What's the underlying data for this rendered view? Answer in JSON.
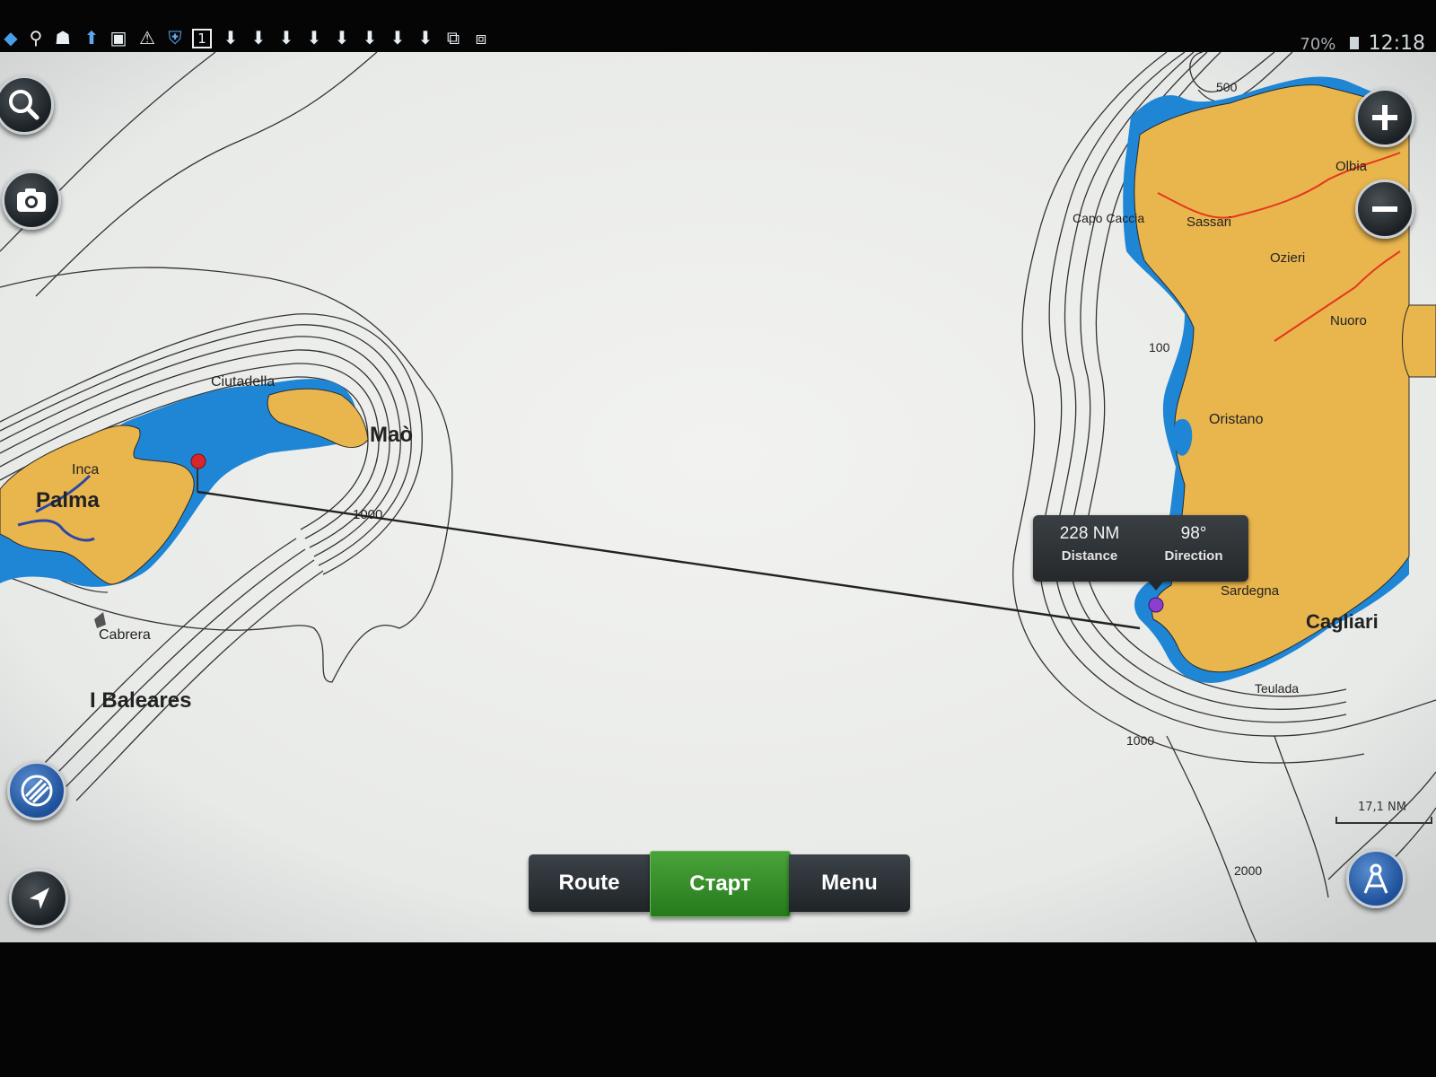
{
  "status_bar": {
    "icons": [
      "app-icon",
      "location-pin-icon",
      "android-icon",
      "upload-icon",
      "screenshot-icon",
      "warning-icon",
      "shield-icon",
      "calendar-icon",
      "download-icon",
      "download-icon",
      "download-icon",
      "download-icon",
      "download-icon",
      "download-icon",
      "download-icon",
      "download-icon",
      "camera-upload-icon",
      "photo-upload-icon"
    ],
    "calendar_day": "1",
    "battery": "70%",
    "time": "12:18"
  },
  "map": {
    "labels": {
      "palma": "Palma",
      "inca": "Inca",
      "ciutadella": "Ciutadella",
      "mao": "Maò",
      "cabrera": "Cabrera",
      "baleares": "I Baleares",
      "depth_1000_west": "1000",
      "olbia": "Olbia",
      "sassari": "Sassari",
      "ozieri": "Ozieri",
      "capo_caccia": "Capo Caccia",
      "nuoro": "Nuoro",
      "oristano": "Oristano",
      "sardegna": "Sardegna",
      "cagliari": "Cagliari",
      "teulada": "Teulada",
      "depth_500": "500",
      "depth_100": "100",
      "depth_1000_east": "1000",
      "depth_2000": "2000"
    },
    "colors": {
      "land": "#e9b54d",
      "shallow_water": "#1f86d6",
      "water": "#f2f3f0",
      "roads": "#e5361f",
      "contours": "#333333"
    }
  },
  "measure": {
    "distance_value": "228 NM",
    "distance_label": "Distance",
    "direction_value": "98°",
    "direction_label": "Direction"
  },
  "scale": {
    "label": "17,1 NM"
  },
  "controls": {
    "left": [
      "search-icon",
      "camera-icon",
      "layers-icon",
      "navigation-arrow-icon"
    ],
    "right": [
      "zoom-in-icon",
      "zoom-out-icon",
      "compass-icon"
    ]
  },
  "bottom_bar": {
    "route": "Route",
    "start": "Старт",
    "menu": "Menu"
  }
}
